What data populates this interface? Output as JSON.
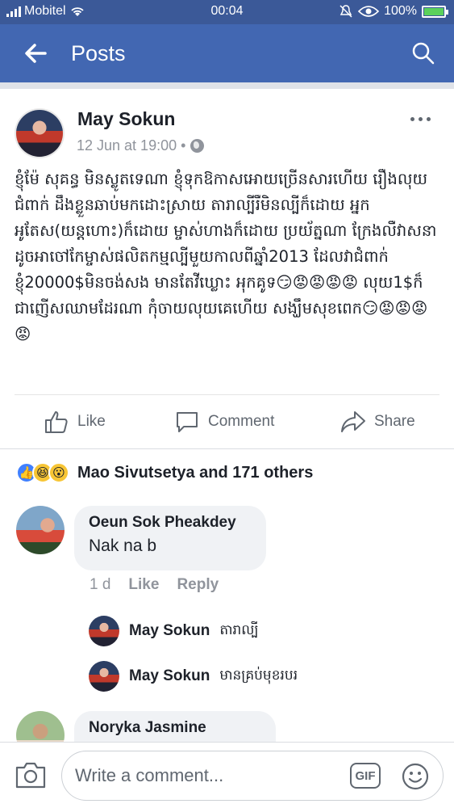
{
  "status_bar": {
    "carrier": "Mobitel",
    "time": "00:04",
    "battery": "100%"
  },
  "header": {
    "title": "Posts"
  },
  "post": {
    "author": "May Sokun",
    "timestamp": "12 Jun at 19:00 •",
    "text": "ខ្ញុំម៉ែ សុគន្ធ មិនស្លូតទេណា ខ្ញុំទុកឱកាសអោយច្រើនសារហើយ រឿងលុយជំពាក់ ដឹងខ្លួនឆាប់មកដោះស្រាយ តារាល្បីរឺមិនល្បីក៏ដោយ អ្នកអូតែស(យន្តហោះ)ក៏ដោយ ម្ចាស់ហាងក៏ដោយ ប្រយ័ត្នណា ក្រែងលឺវាសនាដូចអាចៅកែម្ចាស់ផលិតកម្មល្បីមួយកាលពីឆ្នាំ2013 ដែលវាជំពាក់ខ្ញុំ20000$មិនចង់សង មានតែវីឃ្លោះ អុកគូទ😏😡😡😡😡 លុយ1$ក៏ជាញើសឈាមដែរណា កុំចាយលុយគេហើយ សង្ឃឹមសុខពេក😏😡😡😡😡",
    "actions": {
      "like": "Like",
      "comment": "Comment",
      "share": "Share"
    }
  },
  "reactions": {
    "summary": "Mao Sivutsetya and 171 others"
  },
  "comments": [
    {
      "author": "Oeun Sok Pheakdey",
      "text": "Nak na b",
      "time": "1 d",
      "like_label": "Like",
      "reply_label": "Reply",
      "replies": [
        {
          "author": "May Sokun",
          "text": "តារាល្បី"
        },
        {
          "author": "May Sokun",
          "text": "មានគ្រប់មុខរបរ"
        }
      ]
    },
    {
      "author": "Noryka Jasmine"
    }
  ],
  "composer": {
    "placeholder": "Write a comment...",
    "gif_label": "GIF"
  },
  "colors": {
    "brand_blue": "#4267b2",
    "status_blue": "#3b5998",
    "secondary_text": "#90949c"
  },
  "icons": [
    "signal-icon",
    "wifi-icon",
    "mute-bell-icon",
    "eye-icon",
    "battery-icon",
    "back-arrow-icon",
    "search-icon",
    "more-icon",
    "globe-icon",
    "like-icon",
    "comment-icon",
    "share-icon",
    "camera-icon",
    "gif-icon",
    "smiley-icon"
  ]
}
